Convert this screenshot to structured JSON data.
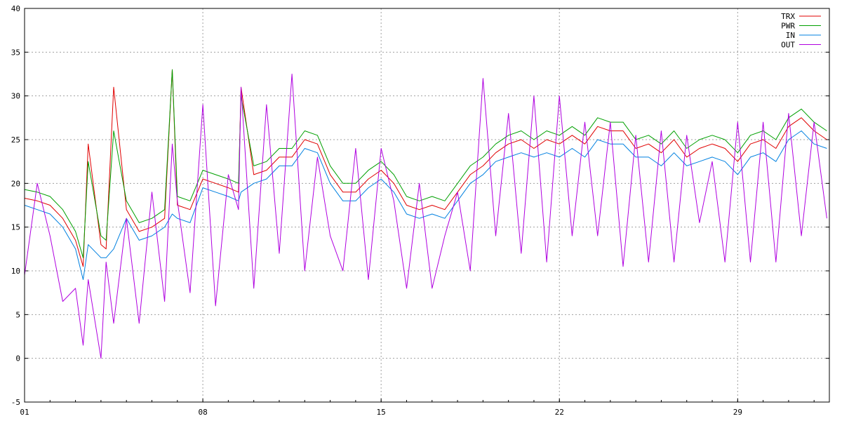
{
  "chart_data": {
    "type": "line",
    "title": "",
    "xlabel": "",
    "ylabel": "",
    "xlim": [
      1,
      32.6
    ],
    "ylim": [
      -5,
      40
    ],
    "grid": true,
    "legend_position": "top-right",
    "x_ticks": [
      {
        "value": 1,
        "label": "01"
      },
      {
        "value": 8,
        "label": "08"
      },
      {
        "value": 15,
        "label": "15"
      },
      {
        "value": 22,
        "label": "22"
      },
      {
        "value": 29,
        "label": "29"
      }
    ],
    "y_ticks": [
      {
        "value": -5,
        "label": "-5"
      },
      {
        "value": 0,
        "label": "0"
      },
      {
        "value": 5,
        "label": "5"
      },
      {
        "value": 10,
        "label": "10"
      },
      {
        "value": 15,
        "label": "15"
      },
      {
        "value": 20,
        "label": "20"
      },
      {
        "value": 25,
        "label": "25"
      },
      {
        "value": 30,
        "label": "30"
      },
      {
        "value": 35,
        "label": "35"
      },
      {
        "value": 40,
        "label": "40"
      }
    ],
    "x": [
      1.0,
      1.5,
      2.0,
      2.5,
      3.0,
      3.3,
      3.5,
      4.0,
      4.2,
      4.5,
      5.0,
      5.5,
      6.0,
      6.5,
      6.8,
      7.0,
      7.5,
      8.0,
      8.5,
      9.0,
      9.4,
      9.5,
      10.0,
      10.5,
      11.0,
      11.5,
      12.0,
      12.5,
      13.0,
      13.5,
      14.0,
      14.5,
      15.0,
      15.5,
      16.0,
      16.5,
      17.0,
      17.5,
      18.0,
      18.5,
      19.0,
      19.5,
      20.0,
      20.5,
      21.0,
      21.5,
      22.0,
      22.5,
      23.0,
      23.5,
      24.0,
      24.5,
      25.0,
      25.5,
      26.0,
      26.5,
      27.0,
      27.5,
      28.0,
      28.5,
      29.0,
      29.5,
      30.0,
      30.5,
      31.0,
      31.5,
      32.0,
      32.5
    ],
    "series": [
      {
        "name": "TRX",
        "color": "#e00000",
        "values": [
          18.3,
          18.0,
          17.5,
          16.0,
          13.5,
          10.5,
          24.5,
          13.0,
          12.5,
          31.0,
          17.0,
          14.5,
          15.0,
          16.0,
          33.0,
          17.5,
          17.0,
          20.5,
          20.0,
          19.5,
          19.0,
          31.0,
          21.0,
          21.5,
          23.0,
          23.0,
          25.0,
          24.5,
          21.0,
          19.0,
          19.0,
          20.5,
          21.5,
          20.0,
          17.5,
          17.0,
          17.5,
          17.0,
          19.0,
          21.0,
          22.0,
          23.5,
          24.5,
          25.0,
          24.0,
          25.0,
          24.5,
          25.5,
          24.5,
          26.5,
          26.0,
          26.0,
          24.0,
          24.5,
          23.5,
          25.0,
          23.0,
          24.0,
          24.5,
          24.0,
          22.5,
          24.5,
          25.0,
          24.0,
          26.5,
          27.5,
          26.0,
          25.0
        ]
      },
      {
        "name": "PWR",
        "color": "#00a000",
        "values": [
          19.3,
          19.0,
          18.5,
          17.0,
          14.5,
          11.5,
          22.5,
          14.0,
          13.5,
          26.0,
          18.0,
          15.5,
          16.0,
          17.0,
          33.0,
          18.5,
          18.0,
          21.5,
          21.0,
          20.5,
          20.0,
          30.0,
          22.0,
          22.5,
          24.0,
          24.0,
          26.0,
          25.5,
          22.0,
          20.0,
          20.0,
          21.5,
          22.5,
          21.0,
          18.5,
          18.0,
          18.5,
          18.0,
          20.0,
          22.0,
          23.0,
          24.5,
          25.5,
          26.0,
          25.0,
          26.0,
          25.5,
          26.5,
          25.5,
          27.5,
          27.0,
          27.0,
          25.0,
          25.5,
          24.5,
          26.0,
          24.0,
          25.0,
          25.5,
          25.0,
          23.5,
          25.5,
          26.0,
          25.0,
          27.5,
          28.5,
          27.0,
          26.0
        ]
      },
      {
        "name": "IN",
        "color": "#0080e0",
        "values": [
          17.5,
          17.0,
          16.5,
          15.0,
          12.5,
          9.0,
          13.0,
          11.5,
          11.5,
          12.5,
          16.0,
          13.5,
          14.0,
          15.0,
          16.5,
          16.0,
          15.5,
          19.5,
          19.0,
          18.5,
          18.0,
          19.0,
          20.0,
          20.5,
          22.0,
          22.0,
          24.0,
          23.5,
          20.0,
          18.0,
          18.0,
          19.5,
          20.5,
          19.0,
          16.5,
          16.0,
          16.5,
          16.0,
          18.0,
          20.0,
          21.0,
          22.5,
          23.0,
          23.5,
          23.0,
          23.5,
          23.0,
          24.0,
          23.0,
          25.0,
          24.5,
          24.5,
          23.0,
          23.0,
          22.0,
          23.5,
          22.0,
          22.5,
          23.0,
          22.5,
          21.0,
          23.0,
          23.5,
          22.5,
          25.0,
          26.0,
          24.5,
          24.0
        ]
      },
      {
        "name": "OUT",
        "color": "#b000e0",
        "values": [
          9.5,
          20.0,
          14.0,
          6.5,
          8.0,
          1.5,
          9.0,
          0.0,
          11.0,
          4.0,
          16.0,
          4.0,
          19.0,
          6.5,
          24.5,
          18.0,
          7.5,
          29.0,
          6.0,
          21.0,
          17.0,
          31.0,
          8.0,
          29.0,
          12.0,
          32.5,
          10.0,
          23.0,
          14.0,
          10.0,
          24.0,
          9.0,
          24.0,
          18.0,
          8.0,
          20.0,
          8.0,
          14.0,
          19.0,
          10.0,
          32.0,
          14.0,
          28.0,
          12.0,
          30.0,
          11.0,
          30.0,
          14.0,
          27.0,
          14.0,
          27.0,
          10.5,
          25.5,
          11.0,
          26.0,
          11.0,
          25.5,
          15.5,
          22.5,
          11.0,
          27.0,
          11.0,
          27.0,
          11.0,
          28.0,
          14.0,
          27.0,
          16.0
        ]
      }
    ]
  }
}
